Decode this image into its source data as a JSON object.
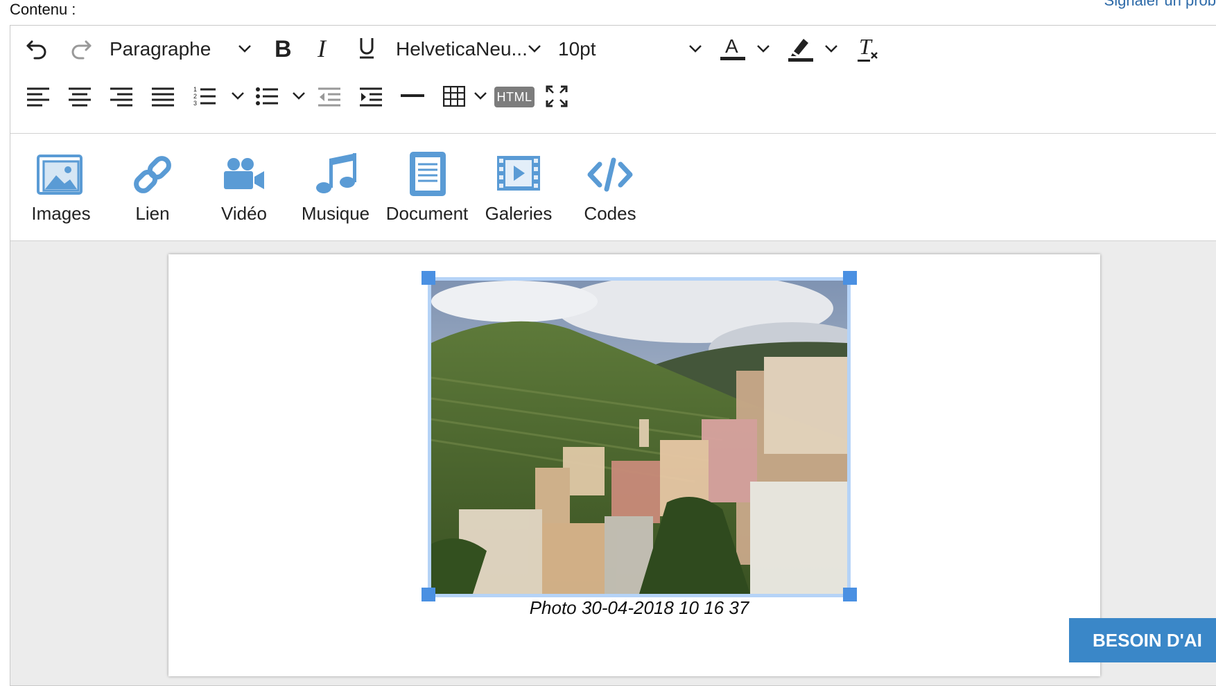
{
  "field_label": "Contenu :",
  "report_link": "Signaler un prob",
  "toolbar": {
    "block_format": "Paragraphe",
    "font_family": "HelveticaNeu...",
    "font_size": "10pt",
    "html_label": "HTML"
  },
  "media": [
    {
      "label": "Images",
      "icon": "images-icon"
    },
    {
      "label": "Lien",
      "icon": "link-icon"
    },
    {
      "label": "Vidéo",
      "icon": "video-camera-icon"
    },
    {
      "label": "Musique",
      "icon": "music-note-icon"
    },
    {
      "label": "Document",
      "icon": "document-icon"
    },
    {
      "label": "Galeries",
      "icon": "film-strip-icon"
    },
    {
      "label": "Codes",
      "icon": "code-icon"
    }
  ],
  "content": {
    "caption": "Photo 30-04-2018 10 16 37"
  },
  "help_button": "BESOIN D'AI",
  "colors": {
    "accent": "#3a87c8",
    "media_icon": "#5a9bd5",
    "selection": "#4a90e2"
  }
}
